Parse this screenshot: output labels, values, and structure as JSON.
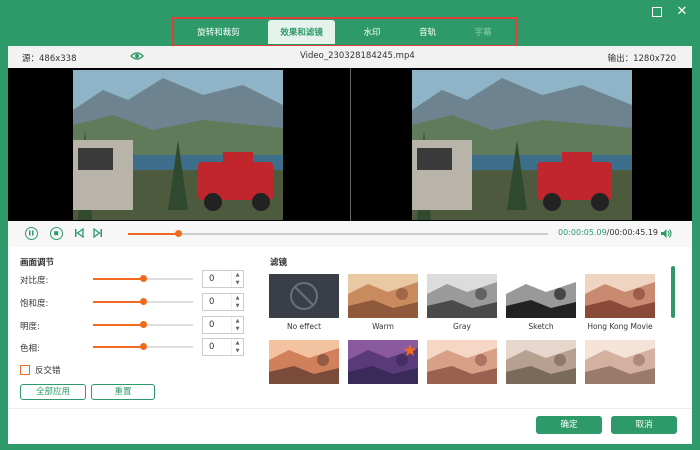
{
  "window": {
    "minimize_glyph": "—",
    "maximize_glyph": "",
    "close_glyph": "✕"
  },
  "tabs": [
    {
      "label": "旋转和裁剪",
      "state": "normal"
    },
    {
      "label": "效果和滤镜",
      "state": "active"
    },
    {
      "label": "水印",
      "state": "normal"
    },
    {
      "label": "音轨",
      "state": "normal"
    },
    {
      "label": "字幕",
      "state": "disabled"
    }
  ],
  "info": {
    "source": "源：486x338",
    "filename": "Video_230328184245.mp4",
    "output": "输出：1280x720"
  },
  "player": {
    "current_time": "00:00:05.09",
    "total_time": "/00:00:45.19",
    "progress": 0.12
  },
  "adjustments": {
    "title": "画面调节",
    "rows": [
      {
        "label": "对比度:",
        "value": "0",
        "level": 0.5
      },
      {
        "label": "饱和度:",
        "value": "0",
        "level": 0.5
      },
      {
        "label": "明度:",
        "value": "0",
        "level": 0.5
      },
      {
        "label": "色相:",
        "value": "0",
        "level": 0.5
      }
    ],
    "deinterlace_label": "反交错",
    "apply_all": "全部应用",
    "reset": "重置"
  },
  "filters": {
    "title": "滤镜",
    "items": [
      {
        "label": "No effect",
        "style": "none"
      },
      {
        "label": "Warm",
        "style": "warm"
      },
      {
        "label": "Gray",
        "style": "gray"
      },
      {
        "label": "Sketch",
        "style": "sketch"
      },
      {
        "label": "Hong Kong Movie",
        "style": "hk"
      },
      {
        "label": "",
        "style": "orange"
      },
      {
        "label": "",
        "style": "purple"
      },
      {
        "label": "",
        "style": "peach"
      },
      {
        "label": "",
        "style": "mosaic"
      },
      {
        "label": "",
        "style": "pale"
      }
    ]
  },
  "footer": {
    "confirm": "确定",
    "cancel": "取消"
  },
  "colors": {
    "brand": "#2e9a6a",
    "accent": "#f06a1e",
    "highlight_border": "#e0403a"
  }
}
